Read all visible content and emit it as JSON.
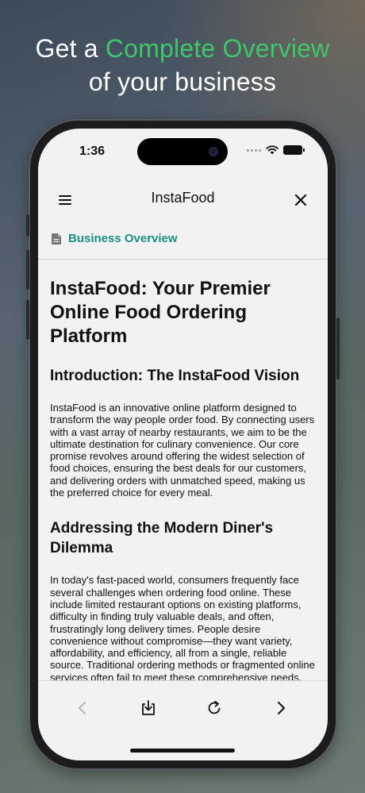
{
  "headline": {
    "prefix": "Get a ",
    "accent": "Complete Overview",
    "line2": "of your business"
  },
  "status_bar": {
    "time": "1:36",
    "icons": [
      "cellular-signal-icon",
      "wifi-icon",
      "battery-icon"
    ]
  },
  "nav": {
    "title": "InstaFood",
    "left_icon": "menu-icon",
    "right_icon": "close-icon"
  },
  "section": {
    "icon": "document-icon",
    "label": "Business Overview"
  },
  "content": {
    "h1": "InstaFood: Your Premier Online Food Ordering Platform",
    "h2_intro": "Introduction: The InstaFood Vision",
    "p_intro": "InstaFood is an innovative online platform designed to transform the way people order food. By connecting users with a vast array of nearby restaurants, we aim to be the ultimate destination for culinary convenience. Our core promise revolves around offering the widest selection of food choices, ensuring the best deals for our customers, and delivering orders with unmatched speed, making us the preferred choice for every meal.",
    "h2_dilemma": "Addressing the Modern Diner's Dilemma",
    "p_dilemma": "In today's fast-paced world, consumers frequently face several challenges when ordering food online. These include limited restaurant options on existing platforms, difficulty in finding truly valuable deals, and often, frustratingly long delivery times. People desire convenience without compromise—they want variety, affordability, and efficiency, all from a single, reliable source. Traditional ordering methods or fragmented online services often fail to meet these comprehensive needs."
  },
  "toolbar": {
    "buttons": [
      "back-icon",
      "download-icon",
      "reload-icon",
      "forward-icon"
    ],
    "back_disabled": true
  },
  "colors": {
    "accent_green": "#3ec76a",
    "section_teal": "#1a8f82",
    "screen_bg": "#f2f2f2"
  }
}
